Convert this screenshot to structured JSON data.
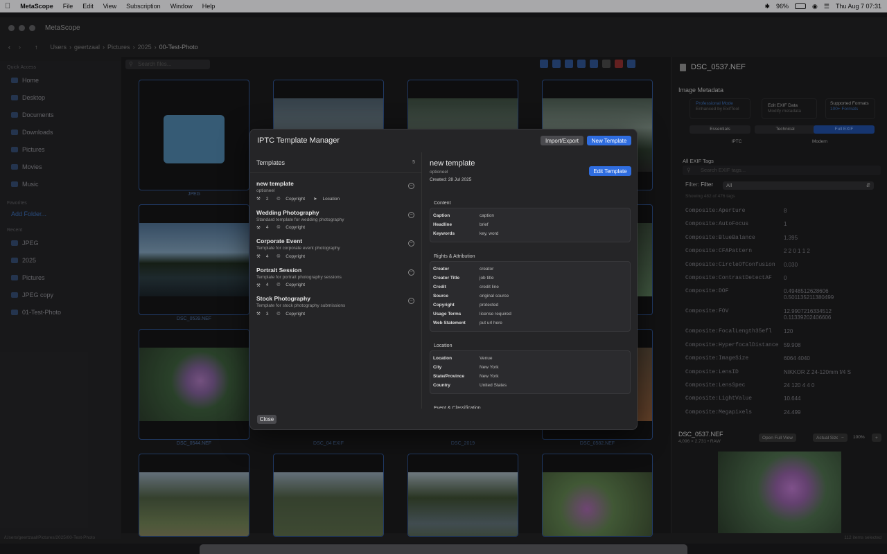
{
  "menubar": {
    "items": [
      "MetaScope",
      "File",
      "Edit",
      "View",
      "Subscription",
      "Window",
      "Help"
    ],
    "battery": "96%",
    "clock": "Thu Aug 7  07:31"
  },
  "window": {
    "title": "MetaScope"
  },
  "path": [
    "Users",
    "geertzaal",
    "Pictures",
    "2025",
    "00-Test-Photo"
  ],
  "search": {
    "placeholder": "Search files..."
  },
  "sidebar": {
    "sections": {
      "quick": "Quick Access",
      "fav": "Favorites",
      "recent": "Recent"
    },
    "quick": [
      "Home",
      "Desktop",
      "Documents",
      "Downloads",
      "Pictures",
      "Movies",
      "Music"
    ],
    "fav": [
      "Add Folder..."
    ],
    "recent": [
      "JPEG",
      "2025",
      "Pictures",
      "JPEG copy",
      "01-Test-Photo"
    ]
  },
  "grid": {
    "labels": [
      "JPEG",
      "DSC_0539.NEF",
      "DSC_0544.NEF",
      "DSC_04 EXIF",
      "DSC_2019",
      "DSC_0582.NEF"
    ]
  },
  "status": {
    "path": "/Users/geertzaal/Pictures/2025/00-Test-Photo",
    "count": "112 items selected"
  },
  "right_panel": {
    "filename": "DSC_0537.NEF",
    "section": "Image Metadata",
    "cards": [
      [
        "Professional Mode",
        "Enhanced by ExifTool"
      ],
      [
        "Edit EXIF Data",
        "Modify metadata"
      ],
      [
        "Supported Formats",
        "100+ Formats"
      ]
    ],
    "tabs": [
      "Essentials",
      "Technical",
      "Full EXIF",
      "IPTC",
      "Modern"
    ],
    "all_tags": "All EXIF Tags",
    "search_ph": "Search EXIF tags...",
    "filter_label": "Filter:",
    "filter_label2": "Filter",
    "filter_value": "All",
    "showing": "Showing 482 of 476 tags",
    "exif": [
      [
        "Composite:Aperture",
        "8"
      ],
      [
        "Composite:AutoFocus",
        "1"
      ],
      [
        "Composite:BlueBalance",
        "1.395"
      ],
      [
        "Composite:CFAPattern",
        "2 2 0 1 1 2"
      ],
      [
        "Composite:CircleOfConfusion",
        "0.030"
      ],
      [
        "Composite:ContrastDetectAF",
        "0"
      ],
      [
        "Composite:DOF",
        "0.4948512628606\n0.501135211380499"
      ],
      [
        "Composite:FOV",
        "12.9907216334512\n0.11339202406606"
      ],
      [
        "Composite:FocalLength35efl",
        "120"
      ],
      [
        "Composite:HyperfocalDistance",
        "59.908"
      ],
      [
        "Composite:ImageSize",
        "6064 4040"
      ],
      [
        "Composite:LensID",
        "NIKKOR Z 24-120mm f/4 S"
      ],
      [
        "Composite:LensSpec",
        "24 120 4 4 0"
      ],
      [
        "Composite:LightValue",
        "10.644"
      ],
      [
        "Composite:Megapixels",
        "24.499"
      ]
    ],
    "preview_name": "DSC_0537.NEF",
    "preview_info": "4,096 × 2,731 • RAW",
    "open_full": "Open Full View",
    "actual_size": "Actual Size",
    "zoom": "100%",
    "zoom_out": "−",
    "zoom_in": "+"
  },
  "modal": {
    "title": "IPTC Template Manager",
    "import_export": "Import/Export",
    "new_template": "New Template",
    "list_header": "Templates",
    "list_count": "5",
    "templates": [
      {
        "name": "new template",
        "desc": "optioneel",
        "count": "2",
        "tag1": "Copyright",
        "tag2": "Location"
      },
      {
        "name": "Wedding Photography",
        "desc": "Standard template for wedding photography",
        "count": "4",
        "tag1": "Copyright"
      },
      {
        "name": "Corporate Event",
        "desc": "Template for corporate event photography",
        "count": "4",
        "tag1": "Copyright"
      },
      {
        "name": "Portrait Session",
        "desc": "Template for portrait photography sessions",
        "count": "4",
        "tag1": "Copyright"
      },
      {
        "name": "Stock Photography",
        "desc": "Template for stock photography submissions",
        "count": "3",
        "tag1": "Copyright"
      }
    ],
    "detail": {
      "name": "new template",
      "desc": "optioneel",
      "created": "Created: 28 Jul 2025",
      "edit": "Edit Template",
      "sections": [
        {
          "title": "Content",
          "rows": [
            [
              "Caption",
              "caption"
            ],
            [
              "Headline",
              "brief"
            ],
            [
              "Keywords",
              "key, word"
            ]
          ]
        },
        {
          "title": "Rights & Attribution",
          "rows": [
            [
              "Creator",
              "creator"
            ],
            [
              "Creator Title",
              "job title"
            ],
            [
              "Credit",
              "credit line"
            ],
            [
              "Source",
              "original source"
            ],
            [
              "Copyright",
              "protected"
            ],
            [
              "Usage Terms",
              "license required"
            ],
            [
              "Web Statement",
              "put url here"
            ]
          ]
        },
        {
          "title": "Location",
          "rows": [
            [
              "Location",
              "Venue"
            ],
            [
              "City",
              "New York"
            ],
            [
              "State/Province",
              "New York"
            ],
            [
              "Country",
              "United States"
            ]
          ]
        },
        {
          "title": "Event & Classification",
          "rows": []
        }
      ]
    },
    "close": "Close"
  }
}
